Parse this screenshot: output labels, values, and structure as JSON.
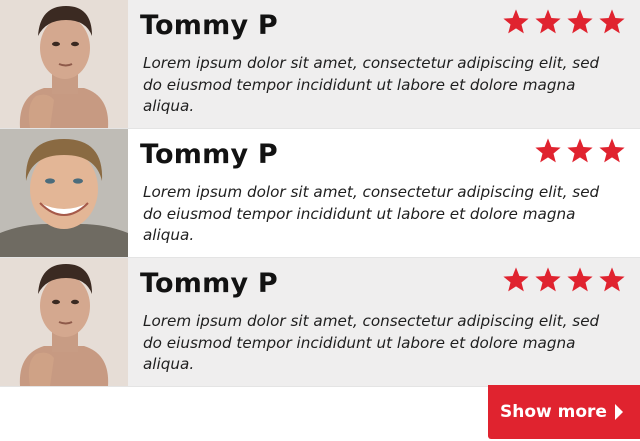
{
  "reviews": [
    {
      "name": "Tommy P",
      "rating": 4,
      "text": "Lorem ipsum dolor sit amet, consectetur adipiscing elit, sed do eiusmod tempor incididunt ut labore et dolore magna aliqua.",
      "avatar": "man-portrait-hand-on-chin"
    },
    {
      "name": "Tommy P",
      "rating": 3,
      "text": "Lorem ipsum dolor sit amet, consectetur adipiscing elit, sed do eiusmod tempor incididunt ut labore et dolore magna aliqua.",
      "avatar": "smiling-blond-man-portrait"
    },
    {
      "name": "Tommy P",
      "rating": 4,
      "text": "Lorem ipsum dolor sit amet, consectetur adipiscing elit, sed do eiusmod tempor incididunt ut labore et dolore magna aliqua.",
      "avatar": "man-portrait-hand-on-chin"
    }
  ],
  "show_more": {
    "label": "Show more",
    "icon": "chevron-right-icon"
  },
  "colors": {
    "accent": "#e0232f",
    "star": "#e0232f",
    "shaded_row": "#efeeee"
  }
}
